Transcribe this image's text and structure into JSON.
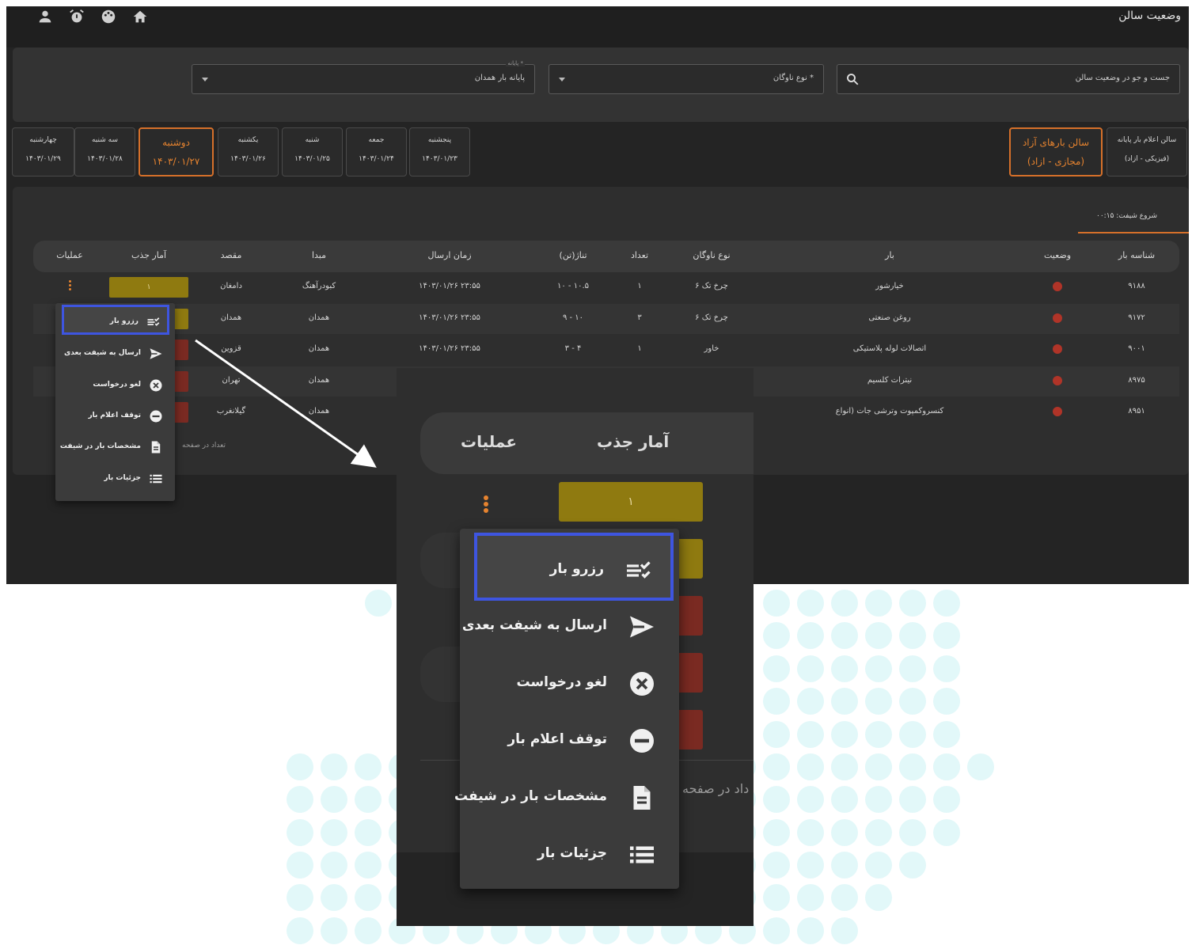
{
  "app": {
    "title": "وضعیت سالن"
  },
  "filters": {
    "search_placeholder": "جست و جو در وضعیت سالن",
    "fleet_type_label": "نوع ناوگان *",
    "terminal_float_label": "پایانه *",
    "terminal_value": "پایانه بار همدان"
  },
  "halls": [
    {
      "line1": "سالن اعلام بار پایانه",
      "line2": "(فیزیکی - ازاد)"
    },
    {
      "line1": "سالن بارهای آزاد",
      "line2": "(مجازی - ازاد)"
    }
  ],
  "days": [
    {
      "day": "پنجشنبه",
      "date": "۱۴۰۳/۰۱/۲۳"
    },
    {
      "day": "جمعه",
      "date": "۱۴۰۳/۰۱/۲۴"
    },
    {
      "day": "شنبه",
      "date": "۱۴۰۳/۰۱/۲۵"
    },
    {
      "day": "یکشنبه",
      "date": "۱۴۰۳/۰۱/۲۶"
    },
    {
      "day": "دوشنبه",
      "date": "۱۴۰۳/۰۱/۲۷"
    },
    {
      "day": "سه شنبه",
      "date": "۱۴۰۳/۰۱/۲۸"
    },
    {
      "day": "چهارشنبه",
      "date": "۱۴۰۳/۰۱/۲۹"
    }
  ],
  "shift_label": "شروع شیفت: ۰۰:۱۵",
  "table": {
    "columns": [
      "شناسه بار",
      "وضعیت",
      "بار",
      "نوع ناوگان",
      "تعداد",
      "تناژ(تن)",
      "زمان ارسال",
      "مبدا",
      "مقصد",
      "آمار جذب",
      "عملیات"
    ],
    "rows": [
      {
        "id": "۹۱۸۸",
        "cargo": "خیارشور",
        "fleet": "۶ چرخ تک",
        "count": "۱",
        "tonnage": "۱۰ - ۱۰.۵",
        "time": "۱۴۰۳/۰۱/۲۶ ۲۳:۵۵",
        "origin": "کبودرآهنگ",
        "dest": "دامغان",
        "stat": "۱"
      },
      {
        "id": "۹۱۷۲",
        "cargo": "روغن صنعتی",
        "fleet": "۶ چرخ تک",
        "count": "۳",
        "tonnage": "۹ - ۱۰",
        "time": "۱۴۰۳/۰۱/۲۶ ۲۳:۵۵",
        "origin": "همدان",
        "dest": "همدان",
        "stat": ""
      },
      {
        "id": "۹۰۰۱",
        "cargo": "اتصالات لوله پلاستیکی",
        "fleet": "خاور",
        "count": "۱",
        "tonnage": "۳ - ۴",
        "time": "۱۴۰۳/۰۱/۲۶ ۲۳:۵۵",
        "origin": "همدان",
        "dest": "قزوین",
        "stat": ""
      },
      {
        "id": "۸۹۷۵",
        "cargo": "نیترات کلسیم",
        "fleet": "",
        "count": "",
        "tonnage": "",
        "time": "",
        "origin": "همدان",
        "dest": "تهران",
        "stat": ""
      },
      {
        "id": "۸۹۵۱",
        "cargo": "کنسروکمپوت وترشی جات (انواع",
        "fleet": "",
        "count": "",
        "tonnage": "",
        "time": "",
        "origin": "همدان",
        "dest": "گیلانغرب",
        "stat": ""
      }
    ],
    "per_page_label": "تعداد در صفحه"
  },
  "menu": {
    "items": [
      {
        "label": "رزرو بار",
        "icon": "checklist-icon"
      },
      {
        "label": "ارسال به شیفت بعدی",
        "icon": "send-icon"
      },
      {
        "label": "لغو درخواست",
        "icon": "cancel-circle-icon"
      },
      {
        "label": "توقف اعلام بار",
        "icon": "stop-circle-icon"
      },
      {
        "label": "مشخصات بار در شیفت",
        "icon": "document-icon"
      },
      {
        "label": "جزئیات بار",
        "icon": "list-icon"
      }
    ]
  },
  "zoom": {
    "col_stats": "آمار جذب",
    "col_ops": "عملیات",
    "stat_value": "۱",
    "per_page_fragment": "داد در صفحه"
  },
  "colors": {
    "accent_orange": "#e6832f",
    "highlight_blue": "#3e55e0",
    "status_red": "#b03428",
    "stat_gold": "#8f7a10",
    "stat_red": "#7a2a22",
    "dot_bg": "#e2f8f9"
  }
}
